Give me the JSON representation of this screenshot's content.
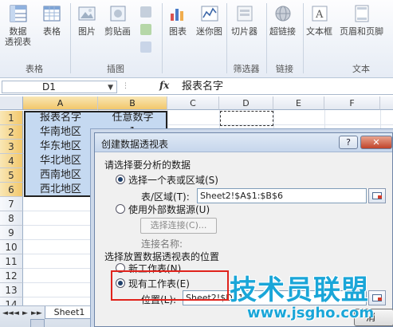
{
  "ribbon": {
    "groups": [
      {
        "label": "表格",
        "buttons": [
          {
            "label1": "数据",
            "label2": "透视表",
            "icon": "pivot-table-icon"
          },
          {
            "label1": "表格",
            "label2": "",
            "icon": "table-icon"
          }
        ]
      },
      {
        "label": "插图",
        "buttons": [
          {
            "label1": "图片",
            "label2": "",
            "icon": "picture-icon"
          },
          {
            "label1": "剪贴画",
            "label2": "",
            "icon": "clipart-icon"
          }
        ]
      },
      {
        "label": "",
        "buttons": [
          {
            "label1": "图表",
            "label2": "",
            "icon": "chart-icon"
          },
          {
            "label1": "迷你图",
            "label2": "",
            "icon": "sparkline-icon"
          }
        ]
      },
      {
        "label": "筛选器",
        "buttons": [
          {
            "label1": "切片器",
            "label2": "",
            "icon": "slicer-icon"
          }
        ]
      },
      {
        "label": "链接",
        "buttons": [
          {
            "label1": "超链接",
            "label2": "",
            "icon": "hyperlink-icon"
          }
        ]
      },
      {
        "label": "文本",
        "buttons": [
          {
            "label1": "文本框",
            "label2": "",
            "icon": "textbox-icon"
          },
          {
            "label1": "页眉和页脚",
            "label2": "",
            "icon": "header-footer-icon"
          }
        ]
      }
    ]
  },
  "formula_bar": {
    "name_box": "D1",
    "fx": "fx",
    "content": "报表名字"
  },
  "grid": {
    "columns": [
      "A",
      "B",
      "C",
      "D",
      "E",
      "F"
    ],
    "rows": [
      "1",
      "2",
      "3",
      "4",
      "5",
      "6",
      "7",
      "8",
      "9",
      "10",
      "11",
      "12",
      "13",
      "14"
    ],
    "cells": [
      [
        "报表名字",
        "任意数字"
      ],
      [
        "华南地区",
        "1"
      ],
      [
        "华东地区",
        ""
      ],
      [
        "华北地区",
        ""
      ],
      [
        "西南地区",
        ""
      ],
      [
        "西北地区",
        ""
      ]
    ]
  },
  "sheet_tabs": {
    "nav": [
      "◄◄",
      "◄",
      "►",
      "►►"
    ],
    "tabs": [
      "Sheet1"
    ]
  },
  "dialog": {
    "title": "创建数据透视表",
    "help": "?",
    "close": "✕",
    "section1": "请选择要分析的数据",
    "option_range": "选择一个表或区域(S)",
    "range_label": "表/区域(T):",
    "range_value": "Sheet2!$A$1:$B$6",
    "option_external": "使用外部数据源(U)",
    "choose_conn": "选择连接(C)...",
    "conn_name_label": "连接名称:",
    "section2": "选择放置数据透视表的位置",
    "option_new": "新工作表(N)",
    "option_existing": "现有工作表(E)",
    "location_label": "位置(L):",
    "location_value": "Sheet2!$D$1",
    "ok_partial": "消"
  },
  "watermark": {
    "text": "技术员联盟",
    "url": "www.jsgho.com"
  }
}
